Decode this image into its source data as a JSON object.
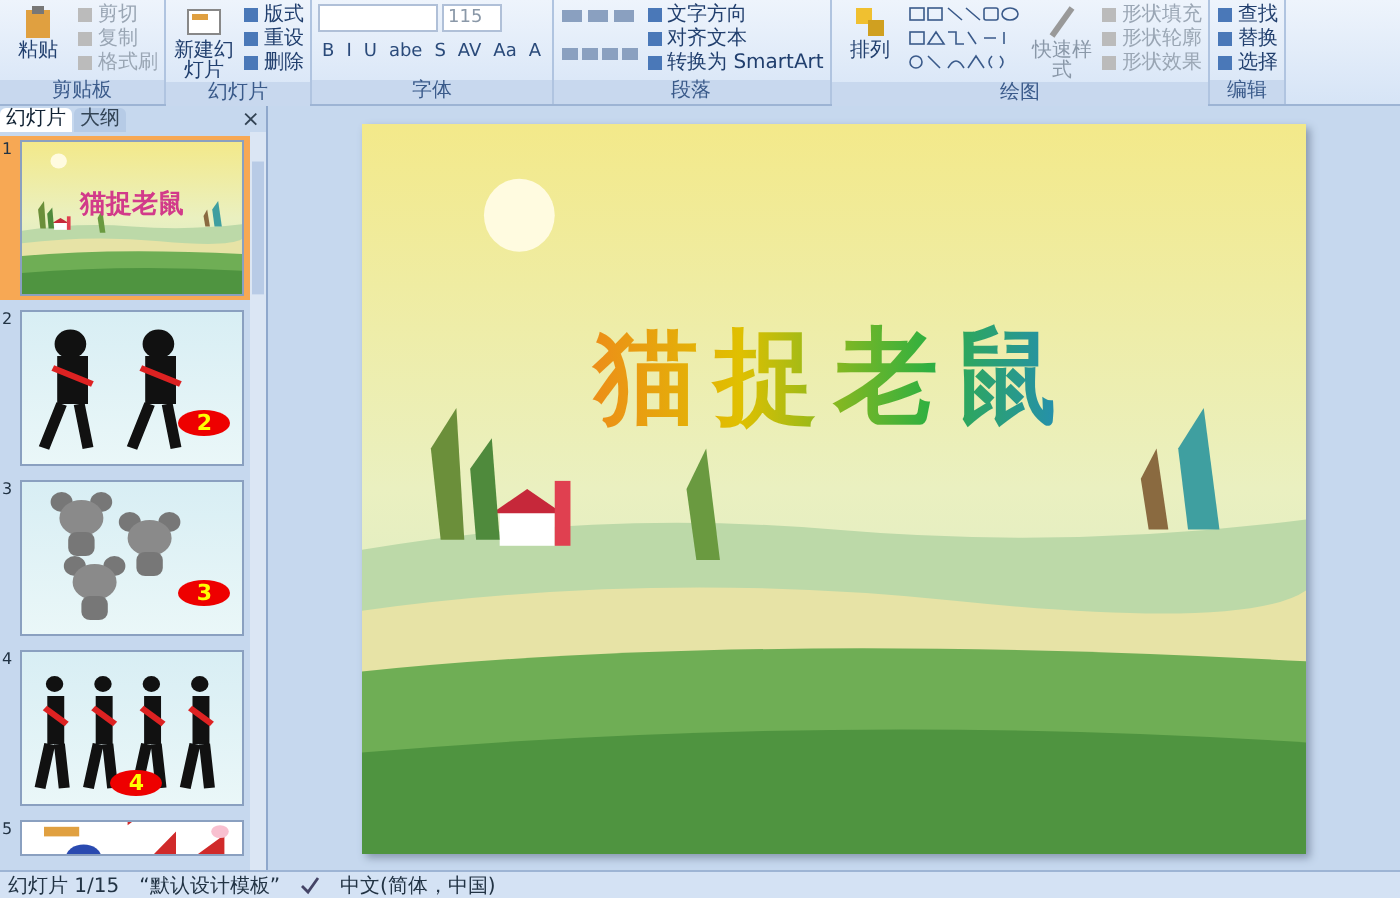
{
  "ribbon": {
    "groups": [
      {
        "label": "剪贴板",
        "kind": "clipboard",
        "large": "粘贴",
        "items": [
          {
            "label": "剪切",
            "disabled": true
          },
          {
            "label": "复制",
            "disabled": true
          },
          {
            "label": "格式刷",
            "disabled": true
          }
        ]
      },
      {
        "label": "幻灯片",
        "kind": "slides",
        "large": "新建幻灯片",
        "items": [
          {
            "label": "版式",
            "disabled": false
          },
          {
            "label": "重设",
            "disabled": false
          },
          {
            "label": "删除",
            "disabled": false
          }
        ]
      },
      {
        "label": "字体",
        "kind": "font",
        "size": "115",
        "buttons": [
          "B",
          "I",
          "U",
          "abe",
          "S",
          "AV",
          "Aa",
          "A"
        ]
      },
      {
        "label": "段落",
        "kind": "paragraph",
        "items": [
          {
            "label": "文字方向",
            "disabled": false
          },
          {
            "label": "对齐文本",
            "disabled": false
          },
          {
            "label": "转换为 SmartArt",
            "disabled": false
          }
        ]
      },
      {
        "label": "绘图",
        "kind": "drawing",
        "large": "排列",
        "quick": "快速样式",
        "items": [
          {
            "label": "形状填充",
            "disabled": true
          },
          {
            "label": "形状轮廓",
            "disabled": true
          },
          {
            "label": "形状效果",
            "disabled": true
          }
        ]
      },
      {
        "label": "编辑",
        "kind": "editing",
        "items": [
          {
            "label": "查找",
            "disabled": false
          },
          {
            "label": "替换",
            "disabled": false
          },
          {
            "label": "选择",
            "disabled": false
          }
        ]
      }
    ]
  },
  "pane": {
    "tabs": [
      {
        "label": "幻灯片",
        "selected": true
      },
      {
        "label": "大纲",
        "selected": false
      }
    ],
    "close": "×"
  },
  "slides": [
    {
      "number": "1",
      "kind": "title",
      "selected": true,
      "title": "猫捉老鼠"
    },
    {
      "number": "2",
      "kind": "cats",
      "selected": false,
      "badge": "2"
    },
    {
      "number": "3",
      "kind": "mice",
      "selected": false,
      "badge": "3"
    },
    {
      "number": "4",
      "kind": "cats4",
      "selected": false,
      "badge": "4"
    },
    {
      "number": "5",
      "kind": "shapes",
      "selected": false
    }
  ],
  "slide": {
    "title": "猫捉老鼠"
  },
  "status_bar": {
    "slide": "幻灯片 1/15",
    "theme": "“默认设计模板”",
    "language": "中文(简体，中国)"
  }
}
